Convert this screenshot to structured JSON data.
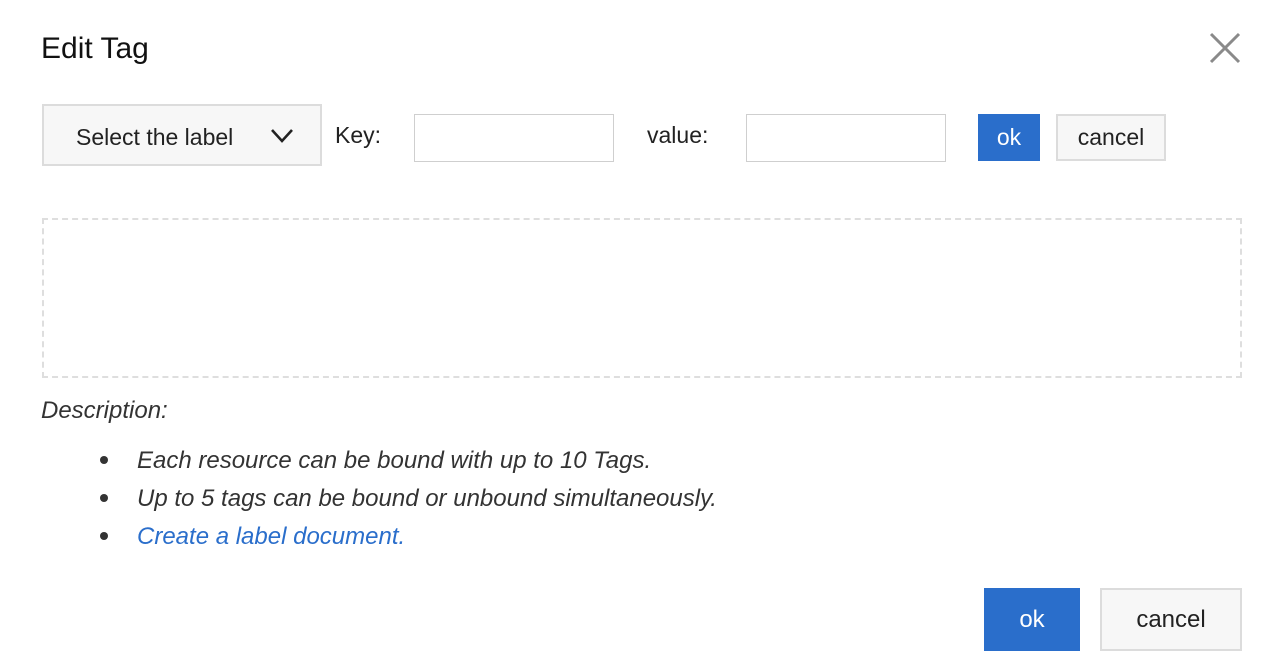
{
  "dialog": {
    "title": "Edit Tag",
    "close_icon": "close-icon"
  },
  "form": {
    "label_select": {
      "text": "Select the label",
      "icon": "chevron-down-icon"
    },
    "key_label": "Key:",
    "key_value": "",
    "value_label": "value:",
    "value_value": "",
    "ok_label": "ok",
    "cancel_label": "cancel"
  },
  "description": {
    "title": "Description:",
    "items": [
      {
        "text": "Each resource can be bound with up to 10 Tags."
      },
      {
        "text": "Up to 5 tags can be bound or unbound simultaneously."
      },
      {
        "text": "Create a label document.",
        "link": true
      }
    ]
  },
  "footer": {
    "ok_label": "ok",
    "cancel_label": "cancel"
  },
  "colors": {
    "primary": "#2a6ecb",
    "link": "#2a6ecb",
    "border": "#dcdcdc",
    "dashed_border": "#dedede"
  }
}
